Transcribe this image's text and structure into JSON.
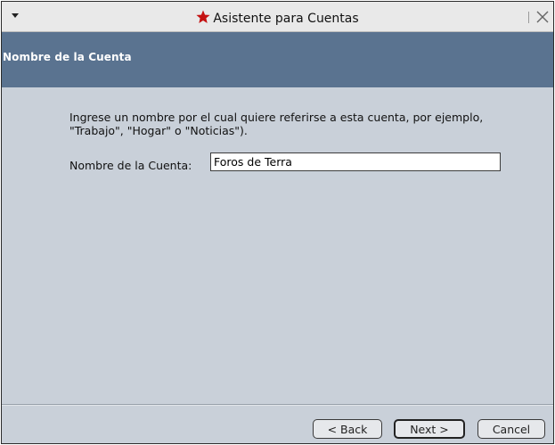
{
  "window": {
    "title": "Asistente para Cuentas",
    "title_icon": "star-icon",
    "menu_icon": "chevron-down-icon",
    "close_icon": "close-icon"
  },
  "header": {
    "title": "Nombre de la Cuenta",
    "background_color": "#5a7390"
  },
  "main": {
    "description": "Ingrese un nombre por el cual quiere referirse a esta cuenta, por ejemplo, \"Trabajo\", \"Hogar\" o \"Noticias\").",
    "account_name_label": "Nombre de la Cuenta:",
    "account_name_value": "Foros de Terra"
  },
  "buttons": {
    "back": "< Back",
    "next": "Next >",
    "cancel": "Cancel"
  }
}
